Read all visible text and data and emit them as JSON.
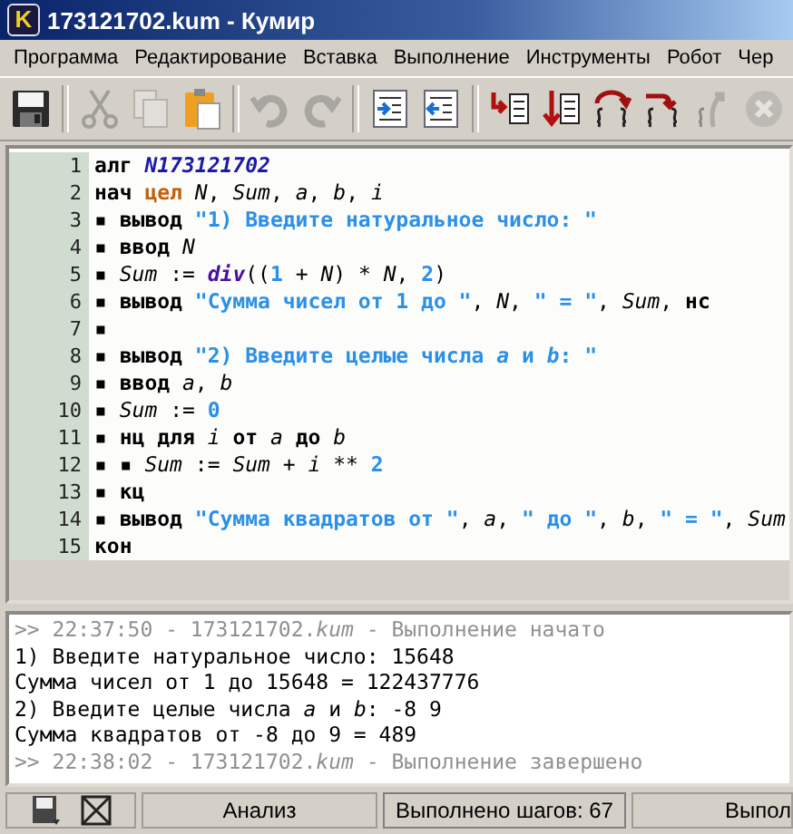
{
  "window": {
    "logo": "K",
    "title": "173121702.kum - Кумир"
  },
  "menu": [
    "Программа",
    "Редактирование",
    "Вставка",
    "Выполнение",
    "Инструменты",
    "Робот",
    "Чер"
  ],
  "toolbar": {
    "groups": [
      [
        {
          "kind": "save",
          "disabled": false
        }
      ],
      [
        {
          "kind": "cut",
          "disabled": true
        },
        {
          "kind": "copy",
          "disabled": true
        },
        {
          "kind": "paste",
          "disabled": false
        }
      ],
      [
        {
          "kind": "undo",
          "disabled": true
        },
        {
          "kind": "redo",
          "disabled": true
        }
      ],
      [
        {
          "kind": "indent",
          "disabled": false
        },
        {
          "kind": "unindent",
          "disabled": false
        }
      ],
      [
        {
          "kind": "step_into",
          "disabled": false
        },
        {
          "kind": "step_down",
          "disabled": false
        },
        {
          "kind": "loop_step",
          "disabled": false
        },
        {
          "kind": "step_out",
          "disabled": false
        },
        {
          "kind": "step_back",
          "disabled": true
        },
        {
          "kind": "stop",
          "disabled": true
        }
      ]
    ]
  },
  "editor": {
    "lines": [
      {
        "number": "1",
        "tokens": [
          {
            "kind": "kw",
            "text": "алг "
          },
          {
            "kind": "alg",
            "text": "N173121702"
          }
        ]
      },
      {
        "number": "2",
        "tokens": [
          {
            "kind": "kw",
            "text": "нач "
          },
          {
            "kind": "type",
            "text": "цел "
          },
          {
            "kind": "var",
            "text": "N"
          },
          {
            "kind": "op",
            "text": ", "
          },
          {
            "kind": "var",
            "text": "Sum"
          },
          {
            "kind": "op",
            "text": ", "
          },
          {
            "kind": "var",
            "text": "a"
          },
          {
            "kind": "op",
            "text": ", "
          },
          {
            "kind": "var",
            "text": "b"
          },
          {
            "kind": "op",
            "text": ", "
          },
          {
            "kind": "var",
            "text": "i"
          }
        ]
      },
      {
        "number": "3",
        "tokens": [
          {
            "kind": "mark",
            "text": "▪ "
          },
          {
            "kind": "kw",
            "text": "вывод "
          },
          {
            "kind": "str",
            "text": "\"1) Введите натуральное число: \""
          }
        ]
      },
      {
        "number": "4",
        "tokens": [
          {
            "kind": "mark",
            "text": "▪ "
          },
          {
            "kind": "kw",
            "text": "ввод "
          },
          {
            "kind": "var",
            "text": "N"
          }
        ]
      },
      {
        "number": "5",
        "tokens": [
          {
            "kind": "mark",
            "text": "▪ "
          },
          {
            "kind": "var",
            "text": "Sum"
          },
          {
            "kind": "op",
            "text": " := "
          },
          {
            "kind": "fn",
            "text": "div"
          },
          {
            "kind": "op",
            "text": "(("
          },
          {
            "kind": "num",
            "text": "1"
          },
          {
            "kind": "op",
            "text": " + "
          },
          {
            "kind": "var",
            "text": "N"
          },
          {
            "kind": "op",
            "text": ") * "
          },
          {
            "kind": "var",
            "text": "N"
          },
          {
            "kind": "op",
            "text": ", "
          },
          {
            "kind": "num",
            "text": "2"
          },
          {
            "kind": "op",
            "text": ")"
          }
        ]
      },
      {
        "number": "6",
        "tokens": [
          {
            "kind": "mark",
            "text": "▪ "
          },
          {
            "kind": "kw",
            "text": "вывод "
          },
          {
            "kind": "str",
            "text": "\"Сумма чисел от 1 до \""
          },
          {
            "kind": "op",
            "text": ", "
          },
          {
            "kind": "var",
            "text": "N"
          },
          {
            "kind": "op",
            "text": ", "
          },
          {
            "kind": "str",
            "text": "\" = \""
          },
          {
            "kind": "op",
            "text": ", "
          },
          {
            "kind": "var",
            "text": "Sum"
          },
          {
            "kind": "op",
            "text": ", "
          },
          {
            "kind": "kw",
            "text": "нс"
          }
        ]
      },
      {
        "number": "7",
        "tokens": [
          {
            "kind": "mark",
            "text": "▪"
          }
        ]
      },
      {
        "number": "8",
        "tokens": [
          {
            "kind": "mark",
            "text": "▪ "
          },
          {
            "kind": "kw",
            "text": "вывод "
          },
          {
            "kind": "str",
            "text": "\"2) Введите целые числа "
          },
          {
            "kind": "strvar",
            "text": "a"
          },
          {
            "kind": "str",
            "text": " и "
          },
          {
            "kind": "strvar",
            "text": "b"
          },
          {
            "kind": "str",
            "text": ": \""
          }
        ]
      },
      {
        "number": "9",
        "tokens": [
          {
            "kind": "mark",
            "text": "▪ "
          },
          {
            "kind": "kw",
            "text": "ввод "
          },
          {
            "kind": "var",
            "text": "a"
          },
          {
            "kind": "op",
            "text": ", "
          },
          {
            "kind": "var",
            "text": "b"
          }
        ]
      },
      {
        "number": "10",
        "tokens": [
          {
            "kind": "mark",
            "text": "▪ "
          },
          {
            "kind": "var",
            "text": "Sum"
          },
          {
            "kind": "op",
            "text": " := "
          },
          {
            "kind": "num",
            "text": "0"
          }
        ]
      },
      {
        "number": "11",
        "tokens": [
          {
            "kind": "mark",
            "text": "▪ "
          },
          {
            "kind": "kw",
            "text": "нц для "
          },
          {
            "kind": "var",
            "text": "i"
          },
          {
            "kind": "kw",
            "text": " от "
          },
          {
            "kind": "var",
            "text": "a"
          },
          {
            "kind": "kw",
            "text": " до "
          },
          {
            "kind": "var",
            "text": "b"
          }
        ]
      },
      {
        "number": "12",
        "tokens": [
          {
            "kind": "mark",
            "text": "▪ ▪ "
          },
          {
            "kind": "var",
            "text": "Sum"
          },
          {
            "kind": "op",
            "text": " := "
          },
          {
            "kind": "var",
            "text": "Sum"
          },
          {
            "kind": "op",
            "text": " + "
          },
          {
            "kind": "var",
            "text": "i"
          },
          {
            "kind": "op",
            "text": " ** "
          },
          {
            "kind": "num",
            "text": "2"
          }
        ]
      },
      {
        "number": "13",
        "tokens": [
          {
            "kind": "mark",
            "text": "▪ "
          },
          {
            "kind": "kw",
            "text": "кц"
          }
        ]
      },
      {
        "number": "14",
        "tokens": [
          {
            "kind": "mark",
            "text": "▪ "
          },
          {
            "kind": "kw",
            "text": "вывод "
          },
          {
            "kind": "str",
            "text": "\"Сумма квадратов от \""
          },
          {
            "kind": "op",
            "text": ", "
          },
          {
            "kind": "var",
            "text": "a"
          },
          {
            "kind": "op",
            "text": ", "
          },
          {
            "kind": "str",
            "text": "\" до \""
          },
          {
            "kind": "op",
            "text": ", "
          },
          {
            "kind": "var",
            "text": "b"
          },
          {
            "kind": "op",
            "text": ", "
          },
          {
            "kind": "str",
            "text": "\" = \""
          },
          {
            "kind": "op",
            "text": ", "
          },
          {
            "kind": "var",
            "text": "Sum"
          }
        ]
      },
      {
        "number": "15",
        "tokens": [
          {
            "kind": "kw",
            "text": "кон"
          }
        ]
      }
    ]
  },
  "output": [
    {
      "kind": "log",
      "text": ">> 22:37:50 - 173121702.*kum* - Выполнение начато"
    },
    {
      "kind": "io",
      "text": "1) Введите натуральное число: 15648"
    },
    {
      "kind": "io",
      "text": "Сумма чисел от 1 до 15648 = 122437776"
    },
    {
      "kind": "io",
      "text": "2) Введите целые числа *a* и *b*: -8 9"
    },
    {
      "kind": "io",
      "text": "Сумма квадратов от -8 до 9 = 489"
    },
    {
      "kind": "log",
      "text": ">> 22:38:02 - 173121702.*kum* - Выполнение завершено"
    }
  ],
  "status_bar": {
    "analysis": "Анализ",
    "steps": "Выполнено шагов: 67",
    "mode": "Выпол"
  }
}
